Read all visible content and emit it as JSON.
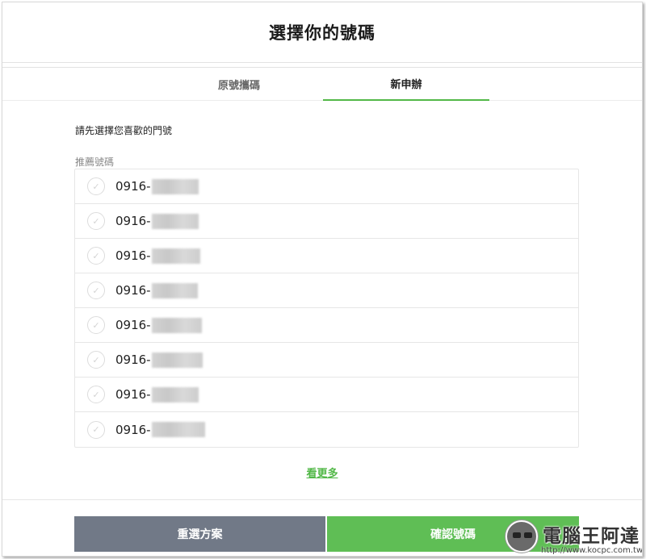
{
  "header": {
    "title": "選擇你的號碼"
  },
  "tabs": [
    {
      "label": "原號攜碼",
      "active": false
    },
    {
      "label": "新申辦",
      "active": true
    }
  ],
  "hint": "請先選擇您喜歡的門號",
  "section_label": "推薦號碼",
  "numbers": [
    {
      "prefix": "0916-"
    },
    {
      "prefix": "0916-"
    },
    {
      "prefix": "0916-"
    },
    {
      "prefix": "0916-"
    },
    {
      "prefix": "0916-"
    },
    {
      "prefix": "0916-"
    },
    {
      "prefix": "0916-"
    },
    {
      "prefix": "0916-"
    }
  ],
  "more_link": "看更多",
  "buttons": {
    "reset": "重選方案",
    "confirm": "確認號碼"
  },
  "watermark": {
    "title": "電腦王阿達",
    "url": "http://www.kocpc.com.tw"
  },
  "colors": {
    "accent_green": "#5fbe55",
    "tab_underline": "#52b848",
    "reset_gray": "#717987"
  },
  "icons": {
    "row_check": "check-circle-icon"
  }
}
